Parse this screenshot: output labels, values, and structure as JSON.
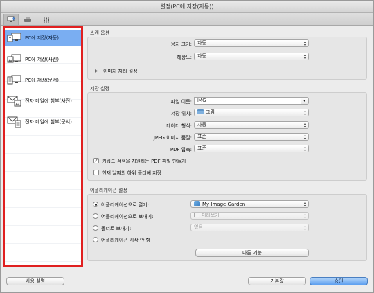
{
  "window": {
    "title": "설정(PC에 저장(자동))"
  },
  "toolbar": {
    "icons": [
      "scan-from-computer-icon",
      "scan-from-panel-icon",
      "general-settings-icon"
    ]
  },
  "sidebar": {
    "items": [
      {
        "label": "PC에 저장(자동)",
        "icon": "save-to-pc-auto-icon",
        "selected": true
      },
      {
        "label": "PC에 저장(사진)",
        "icon": "save-to-pc-photo-icon",
        "selected": false
      },
      {
        "label": "PC에 저장(문서)",
        "icon": "save-to-pc-document-icon",
        "selected": false
      },
      {
        "label": "전자 메일에 첨부(사진)",
        "icon": "email-photo-icon",
        "selected": false
      },
      {
        "label": "전자 메일에 첨부(문서)",
        "icon": "email-document-icon",
        "selected": false
      }
    ]
  },
  "scan_options": {
    "title": "스캔 옵션",
    "paper_size_label": "용지 크기:",
    "paper_size_value": "자동",
    "resolution_label": "해상도:",
    "resolution_value": "자동",
    "image_processing_label": "이미지 처리 설정"
  },
  "save_settings": {
    "title": "저장 설정",
    "file_name_label": "파일 이름:",
    "file_name_value": "IMG",
    "save_in_label": "저장 위치:",
    "save_in_value": "그림",
    "data_format_label": "데이터 형식:",
    "data_format_value": "자동",
    "jpeg_quality_label": "JPEG 이미지 품질:",
    "jpeg_quality_value": "표준",
    "pdf_compression_label": "PDF 압축:",
    "pdf_compression_value": "표준",
    "keyword_pdf_label": "키워드 검색을 지원하는 PDF 파일 만들기",
    "keyword_pdf_checked": true,
    "subfolder_label": "현재 날짜의 하위 폴더에 저장",
    "subfolder_checked": false
  },
  "app_settings": {
    "title": "어플리케이션 설정",
    "open_with_label": "어플리케이션으로 열기:",
    "open_with_value": "My Image Garden",
    "send_to_app_label": "어플리케이션으로 보내기:",
    "send_to_app_value": "미리보기",
    "send_to_folder_label": "폴더로 보내기:",
    "send_to_folder_value": "없음",
    "do_not_start_label": "어플리케이션 시작 안 함",
    "more_functions_label": "다른 기능",
    "selected_option": "open_with"
  },
  "footer": {
    "instructions_label": "사용 설명",
    "defaults_label": "기본값",
    "ok_label": "승인"
  },
  "colors": {
    "highlight_border": "#e02020",
    "selection": "#7aaef2",
    "default_button": "#5d9ff0"
  }
}
